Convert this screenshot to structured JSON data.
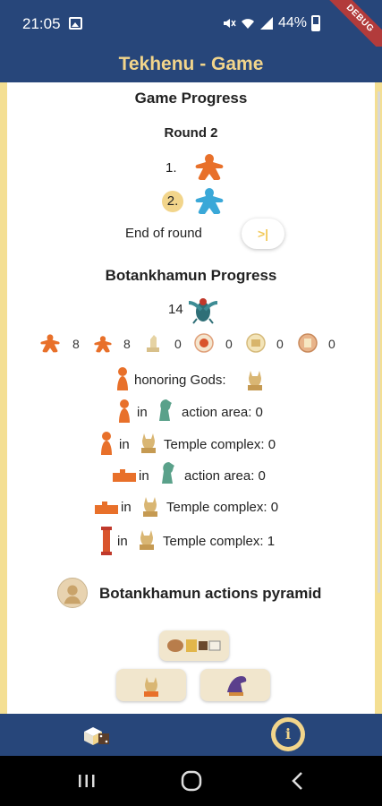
{
  "status_bar": {
    "time": "21:05",
    "battery": "44%",
    "debug": "DEBUG"
  },
  "app_bar": {
    "title": "Tekhenu - Game"
  },
  "progress": {
    "title": "Game Progress",
    "round": "Round 2",
    "players": [
      {
        "rank": "1.",
        "color": "#e8702a",
        "current": false
      },
      {
        "rank": "2.",
        "color": "#3aa8d8",
        "current": true
      }
    ],
    "end_of_round_label": "End of round",
    "end_of_round_button": ">|"
  },
  "player_progress": {
    "title": "Botankhamun Progress",
    "score": "14",
    "resources": [
      "8",
      "8",
      "0",
      "0",
      "0",
      "0"
    ],
    "lines": {
      "honoring": "honoring Gods:",
      "in": "in",
      "action_area_1": "action area: 0",
      "temple_1": "Temple complex: 0",
      "action_area_2": "action area: 0",
      "temple_2": "Temple complex: 0",
      "temple_3": "Temple complex: 1"
    }
  },
  "pyramid": {
    "title": "Botankhamun actions pyramid"
  },
  "colors": {
    "primary": "#27467a",
    "accent": "#f2d58b",
    "orange": "#e8702a",
    "blue": "#3aa8d8"
  }
}
